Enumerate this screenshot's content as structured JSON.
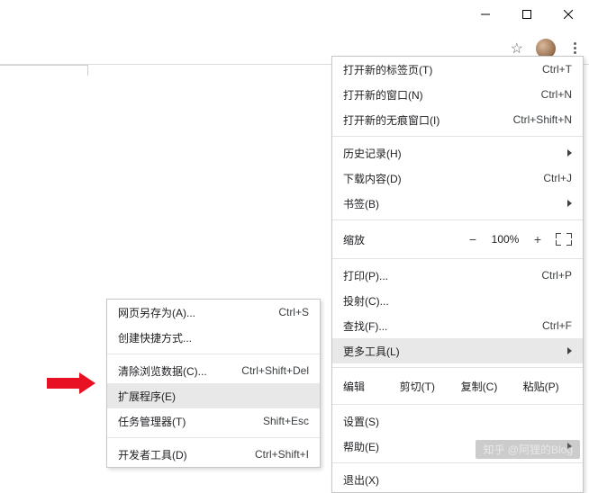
{
  "main_menu": {
    "new_tab": {
      "label": "打开新的标签页(T)",
      "shortcut": "Ctrl+T"
    },
    "new_window": {
      "label": "打开新的窗口(N)",
      "shortcut": "Ctrl+N"
    },
    "new_incognito": {
      "label": "打开新的无痕窗口(I)",
      "shortcut": "Ctrl+Shift+N"
    },
    "history": {
      "label": "历史记录(H)"
    },
    "downloads": {
      "label": "下载内容(D)",
      "shortcut": "Ctrl+J"
    },
    "bookmarks": {
      "label": "书签(B)"
    },
    "zoom_label": "缩放",
    "zoom_value": "100%",
    "zoom_minus": "−",
    "zoom_plus": "+",
    "print": {
      "label": "打印(P)...",
      "shortcut": "Ctrl+P"
    },
    "cast": {
      "label": "投射(C)..."
    },
    "find": {
      "label": "查找(F)...",
      "shortcut": "Ctrl+F"
    },
    "more_tools": {
      "label": "更多工具(L)"
    },
    "edit_label": "编辑",
    "cut": "剪切(T)",
    "copy": "复制(C)",
    "paste": "粘贴(P)",
    "settings": {
      "label": "设置(S)"
    },
    "help": {
      "label": "帮助(E)"
    },
    "exit": {
      "label": "退出(X)"
    }
  },
  "sub_menu": {
    "save_as": {
      "label": "网页另存为(A)...",
      "shortcut": "Ctrl+S"
    },
    "create_shortcut": {
      "label": "创建快捷方式..."
    },
    "clear_data": {
      "label": "清除浏览数据(C)...",
      "shortcut": "Ctrl+Shift+Del"
    },
    "extensions": {
      "label": "扩展程序(E)"
    },
    "task_manager": {
      "label": "任务管理器(T)",
      "shortcut": "Shift+Esc"
    },
    "dev_tools": {
      "label": "开发者工具(D)",
      "shortcut": "Ctrl+Shift+I"
    }
  },
  "watermark": "知乎 @阿狸的Blog"
}
